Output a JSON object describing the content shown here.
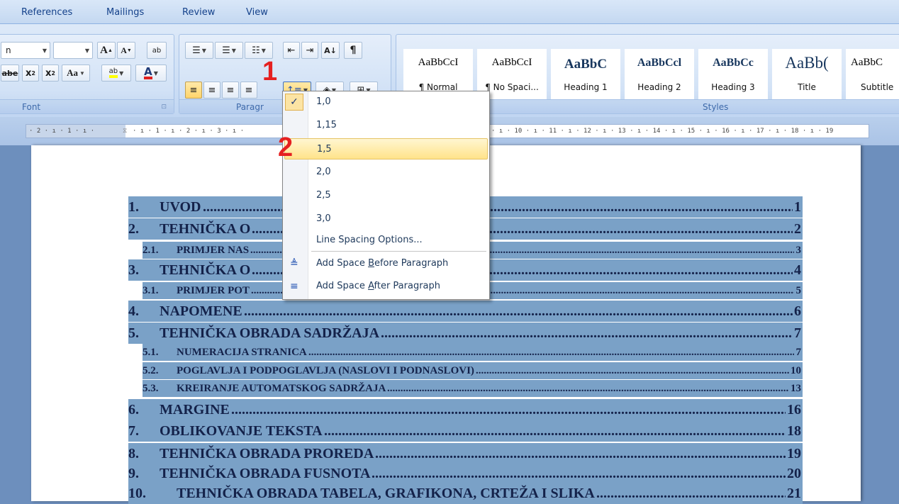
{
  "tabs": [
    "References",
    "Mailings",
    "Review",
    "View"
  ],
  "font_group": {
    "label": "Font",
    "font_name_value": "n",
    "grow_label": "A",
    "shrink_label": "A",
    "clear_label": "ab",
    "strike_label": "abe",
    "sub_label": "x",
    "sup_label": "x",
    "case_label": "Aa",
    "highlight_label": "ab",
    "color_label": "A",
    "launcher_label": "⊡"
  },
  "paragraph_group": {
    "label": "Paragraph",
    "visible_label": "Paragr",
    "sort_label": "A↓",
    "pilcrow_label": "¶"
  },
  "styles_group": {
    "label": "Styles",
    "tiles": [
      {
        "sample": "AaBbCcI",
        "name": "¶ Normal"
      },
      {
        "sample": "AaBbCcI",
        "name": "¶ No Spaci..."
      },
      {
        "sample": "AaBbC",
        "name": "Heading 1"
      },
      {
        "sample": "AaBbCcl",
        "name": "Heading 2"
      },
      {
        "sample": "AaBbCc",
        "name": "Heading 3"
      },
      {
        "sample": "AaBb(",
        "name": "Title"
      },
      {
        "sample": "AaBbC",
        "name": "Subtitle"
      }
    ]
  },
  "ruler": {
    "left_text": "· 2 · ı · 1 · ı ·",
    "mid_text": "· ı · 1 · ı · 2 · ı · 3 · ı ·",
    "right_text": "· ı · 10 · ı · 11 · ı · 12 · ı · 13 · ı · 14 · ı · 15 · ı · 16 · ı · 17 · ı · 18 · ı · 19"
  },
  "line_spacing_menu": {
    "options": [
      "1,0",
      "1,15",
      "1,5",
      "2,0",
      "2,5",
      "3,0"
    ],
    "checked": "1,0",
    "highlighted": "1,5",
    "more_options": "Line Spacing Options...",
    "before": {
      "pre": "Add Space ",
      "u": "B",
      "post": "efore Paragraph"
    },
    "after": {
      "pre": "Add Space ",
      "u": "A",
      "post": "fter Paragraph"
    }
  },
  "step_markers": [
    "1",
    "2"
  ],
  "toc": [
    {
      "num": "1.",
      "title": "UVOD",
      "page": "1",
      "level": 1
    },
    {
      "num": "2.",
      "title": "TEHNIČKA O",
      "page": "2",
      "level": 1
    },
    {
      "num": "2.1.",
      "title": "PRIMJER NAS",
      "page": "3",
      "level": 2
    },
    {
      "num": "3.",
      "title": "TEHNIČKA O",
      "page": "4",
      "level": 1
    },
    {
      "num": "3.1.",
      "title": "PRIMJER POT",
      "page": "5",
      "level": 2
    },
    {
      "num": "4.",
      "title": "NAPOMENE",
      "page": "6",
      "level": 1
    },
    {
      "num": "5.",
      "title": "TEHNIČKA OBRADA SADRŽAJA",
      "page": "7",
      "level": 1
    },
    {
      "num": "5.1.",
      "title": "NUMERACIJA STRANICA",
      "page": "7",
      "level": 2
    },
    {
      "num": "5.2.",
      "title": "POGLAVLJA I PODPOGLAVLJA (NASLOVI I PODNASLOVI)",
      "page": "10",
      "level": 2
    },
    {
      "num": "5.3.",
      "title": "KREIRANJE AUTOMATSKOG SADRŽAJA",
      "page": "13",
      "level": 2
    },
    {
      "num": "6.",
      "title": "MARGINE",
      "page": "16",
      "level": 1
    },
    {
      "num": "7.",
      "title": "OBLIKOVANJE TEKSTA",
      "page": "18",
      "level": 1
    },
    {
      "num": "8.",
      "title": "TEHNIČKA OBRADA PROREDA",
      "page": "19",
      "level": 1
    },
    {
      "num": "9.",
      "title": "TEHNIČKA OBRADA FUSNOTA",
      "page": "20",
      "level": 1
    },
    {
      "num": "10.",
      "title": "TEHNIČKA OBRADA TABELA, GRAFIKONA, CRTEŽA I SLIKA",
      "page": "21",
      "level": 1
    }
  ],
  "colors": {
    "selection": "#7aa1c7",
    "step_red": "#e52020",
    "ribbon_text": "#15428b"
  }
}
